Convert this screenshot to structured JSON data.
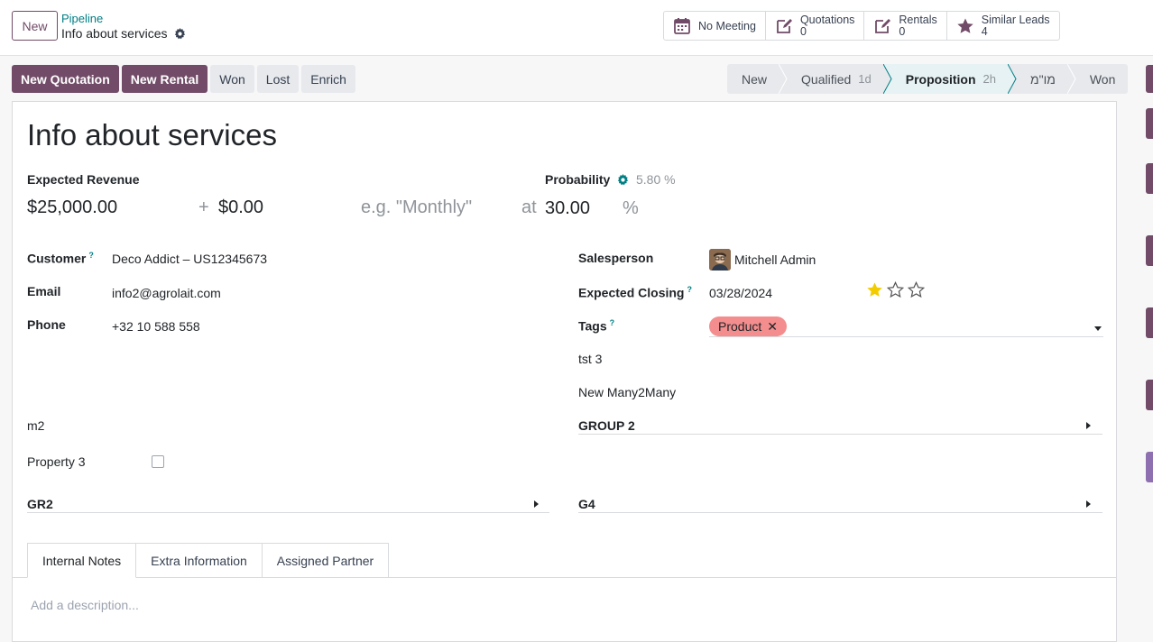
{
  "control_panel": {
    "new_button": "New",
    "breadcrumb": "Pipeline",
    "record_title": "Info about services"
  },
  "smart_buttons": [
    {
      "label": "No Meeting",
      "count": ""
    },
    {
      "label": "Quotations",
      "count": "0"
    },
    {
      "label": "Rentals",
      "count": "0"
    },
    {
      "label": "Similar Leads",
      "count": "4"
    }
  ],
  "actions": {
    "new_quotation": "New Quotation",
    "new_rental": "New Rental",
    "won": "Won",
    "lost": "Lost",
    "enrich": "Enrich"
  },
  "stages": [
    {
      "label": "New",
      "duration": ""
    },
    {
      "label": "Qualified",
      "duration": "1d"
    },
    {
      "label": "Proposition",
      "duration": "2h",
      "active": true
    },
    {
      "label": "מו\"מ",
      "duration": ""
    },
    {
      "label": "Won",
      "duration": ""
    }
  ],
  "form": {
    "lead_name": "Info about services",
    "expected_revenue_label": "Expected Revenue",
    "expected_revenue": "$25,000.00",
    "plus": "+",
    "recurring_revenue": "$0.00",
    "recurring_plan_placeholder": "e.g. \"Monthly\"",
    "at": "at",
    "probability_label": "Probability",
    "automated_probability": "5.80 %",
    "probability": "30.00",
    "percent": "%",
    "customer_label": "Customer",
    "customer": "Deco Addict – US12345673",
    "email_label": "Email",
    "email": "info2@agrolait.com",
    "phone_label": "Phone",
    "phone": "+32 10 588 558",
    "m2_label": "m2",
    "property3_label": "Property 3",
    "gr2_label": "GR2",
    "salesperson_label": "Salesperson",
    "salesperson": "Mitchell Admin",
    "expected_closing_label": "Expected Closing",
    "expected_closing": "03/28/2024",
    "priority_stars": 1,
    "tags_label": "Tags",
    "tag": "Product",
    "tst3_label": "tst 3",
    "new_many2many_label": "New Many2Many",
    "group2_label": "GROUP 2",
    "g4_label": "G4",
    "help_mark": "?"
  },
  "tabs": [
    "Internal Notes",
    "Extra Information",
    "Assigned Partner"
  ],
  "notes_placeholder": "Add a description...",
  "colors": {
    "brand": "#714b67",
    "teal": "#017e84",
    "tag": "#f48d8d",
    "star": "#f3cc00"
  }
}
